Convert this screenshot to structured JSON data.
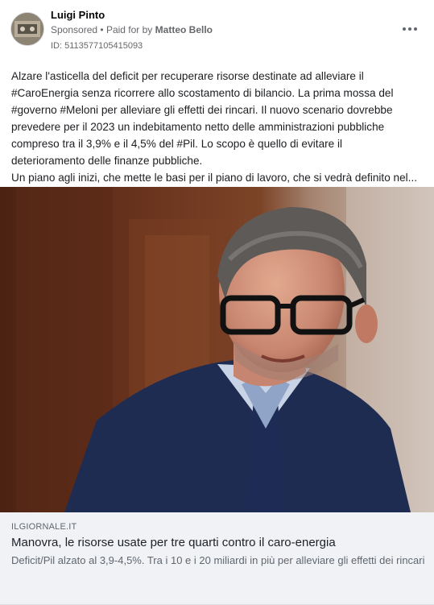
{
  "post": {
    "author": "Luigi Pinto",
    "sponsored_label": "Sponsored",
    "separator": "•",
    "paid_for_label": "Paid for by",
    "payer": "Matteo Bello",
    "ad_id": "ID: 5113577105415093",
    "more_icon": "more-horizontal-icon",
    "body_lines": [
      "Alzare l'asticella del deficit per recuperare risorse destinate ad alleviare il",
      "#CaroEnergia senza ricorrere allo scostamento di bilancio. La prima mossa del",
      "#governo #Meloni per alleviare gli effetti dei rincari. Il nuovo scenario dovrebbe",
      "prevedere per il 2023 un indebitamento netto delle amministrazioni pubbliche",
      "compreso tra il 3,9% e il 4,5% del #Pil. Lo scopo è quello di evitare il",
      "deterioramento delle finanze pubbliche.",
      "Un piano agli inizi, che mette le basi per il piano di lavoro, che si vedrà definito nel..."
    ]
  },
  "link": {
    "domain": "ILGIORNALE.IT",
    "title": "Manovra, le risorse usate per tre quarti contro il caro-energia",
    "description": "Deficit/Pil alzato al 3,9-4,5%. Tra i 10 e i 20 miliardi in più per alleviare gli effetti dei rincari"
  },
  "colors": {
    "text_primary": "#1c1e21",
    "text_secondary": "#65676b",
    "link_box_bg": "#f0f2f5",
    "suit_navy": "#1f2c52",
    "wood_brown": "#6e3620"
  }
}
